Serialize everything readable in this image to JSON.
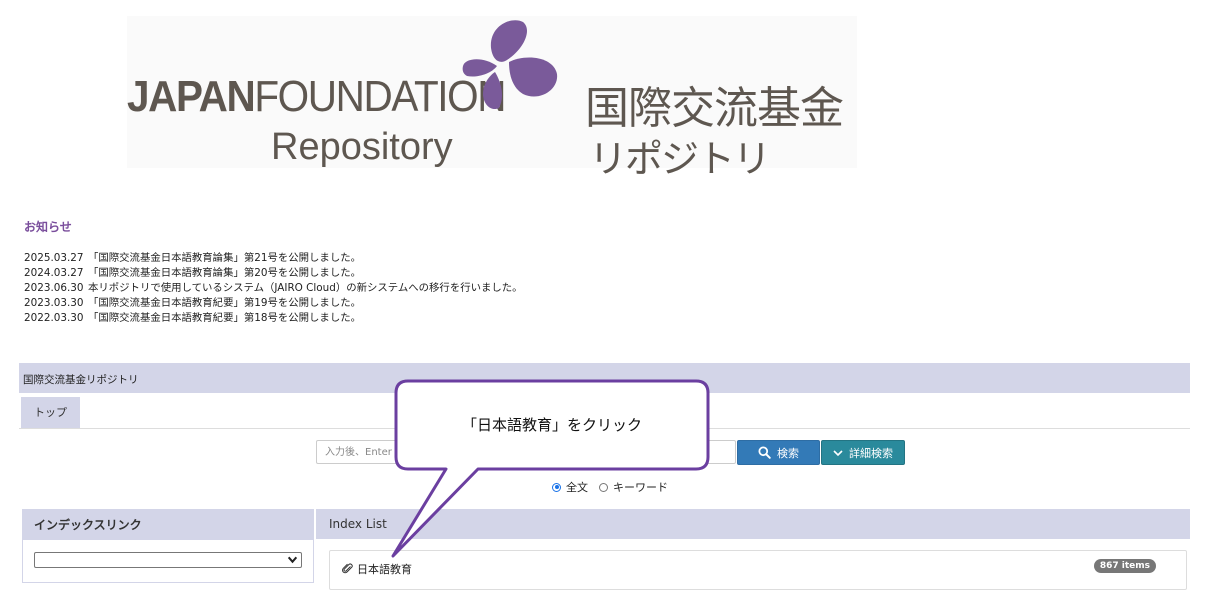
{
  "banner": {
    "japan_bold": "JAPAN",
    "japan_rest": "FOUNDATION",
    "repository": "Repository",
    "jp_line1": "国際交流基金",
    "jp_line2": "リポジトリ",
    "butterfly_color": "#7a5a9a"
  },
  "notices": {
    "heading": "お知らせ",
    "items": [
      {
        "date": "2025.03.27",
        "text": "「国際交流基金日本語教育論集」第21号を公開しました。"
      },
      {
        "date": "2024.03.27",
        "text": "「国際交流基金日本語教育論集」第20号を公開しました。"
      },
      {
        "date": "2023.06.30",
        "text": "本リポジトリで使用しているシステム（JAIRO Cloud）の新システムへの移行を行いました。"
      },
      {
        "date": "2023.03.30",
        "text": "「国際交流基金日本語教育紀要」第19号を公開しました。"
      },
      {
        "date": "2022.03.30",
        "text": "「国際交流基金日本語教育紀要」第18号を公開しました。"
      }
    ]
  },
  "repo": {
    "title": "国際交流基金リポジトリ",
    "tab_top": "トップ"
  },
  "search": {
    "placeholder": "入力後、Enter",
    "search_button": "検索",
    "advanced_button": "詳細検索",
    "options": [
      {
        "label": "全文",
        "checked": true
      },
      {
        "label": "キーワード",
        "checked": false
      }
    ]
  },
  "index_link": {
    "heading": "インデックスリンク",
    "selected": ""
  },
  "index_list": {
    "heading": "Index List",
    "items": [
      {
        "label": "日本語教育",
        "count": "867 items"
      }
    ]
  },
  "callout": {
    "text": "「日本語教育」をクリック",
    "border_color": "#6b3fa0"
  },
  "colors": {
    "accent_purple": "#7a4e9c",
    "panel_header": "#d3d5e8",
    "search_blue": "#337ab7",
    "advanced_teal": "#2a8a9c"
  }
}
